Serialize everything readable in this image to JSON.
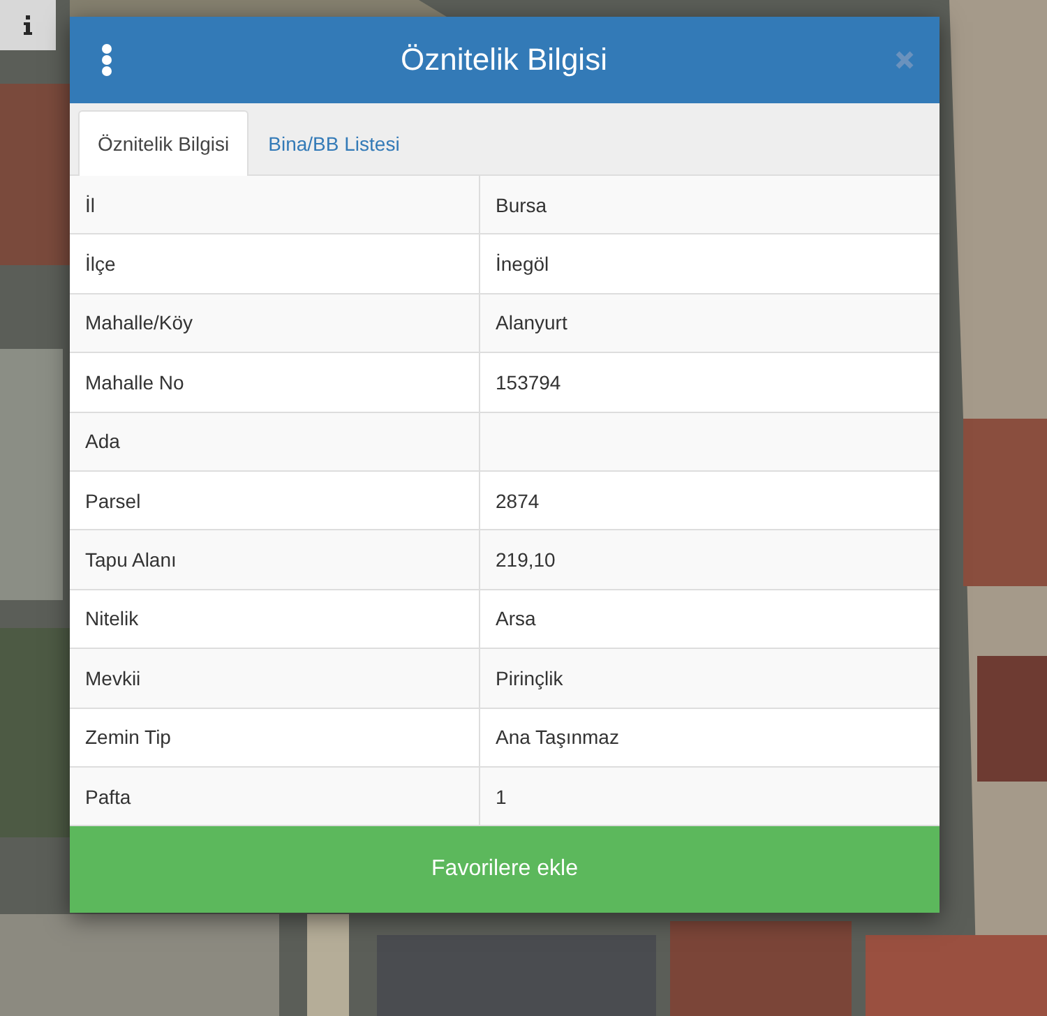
{
  "dialog": {
    "title": "Öznitelik Bilgisi",
    "tabs": [
      {
        "label": "Öznitelik Bilgisi",
        "selected": true
      },
      {
        "label": "Bina/BB Listesi",
        "selected": false
      }
    ],
    "rows": [
      {
        "label": "İl",
        "value": "Bursa"
      },
      {
        "label": "İlçe",
        "value": "İnegöl"
      },
      {
        "label": "Mahalle/Köy",
        "value": "Alanyurt"
      },
      {
        "label": "Mahalle No",
        "value": "153794"
      },
      {
        "label": "Ada",
        "value": ""
      },
      {
        "label": "Parsel",
        "value": "2874"
      },
      {
        "label": "Tapu Alanı",
        "value": "219,10"
      },
      {
        "label": "Nitelik",
        "value": "Arsa"
      },
      {
        "label": "Mevkii",
        "value": "Pirinçlik"
      },
      {
        "label": "Zemin Tip",
        "value": "Ana Taşınmaz"
      },
      {
        "label": "Pafta",
        "value": "1"
      }
    ],
    "button": "Favorilere ekle"
  }
}
